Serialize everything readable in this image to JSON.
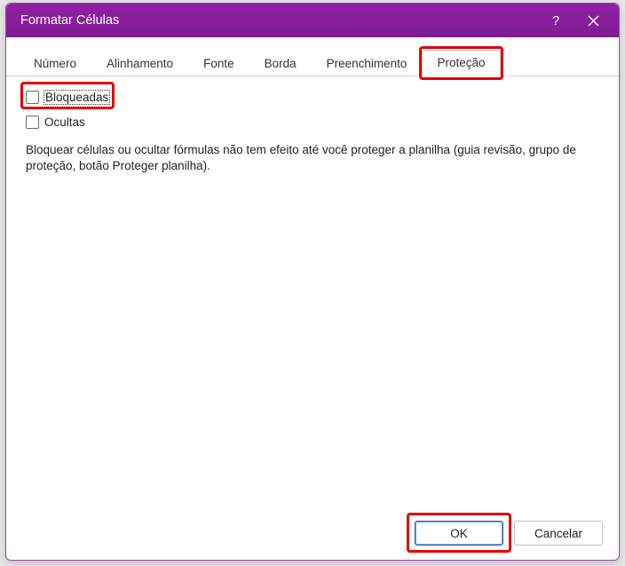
{
  "titlebar": {
    "title": "Formatar Células"
  },
  "tabs": {
    "numero": "Número",
    "alinhamento": "Alinhamento",
    "fonte": "Fonte",
    "borda": "Borda",
    "preenchimento": "Preenchimento",
    "protecao": "Proteção"
  },
  "protection": {
    "bloqueadas_label": "Bloqueadas",
    "ocultas_label": "Ocultas",
    "info_text": "Bloquear células ou ocultar fórmulas não tem efeito até você proteger a planilha (guia revisão, grupo de proteção, botão Proteger planilha)."
  },
  "buttons": {
    "ok": "OK",
    "cancel": "Cancelar"
  }
}
